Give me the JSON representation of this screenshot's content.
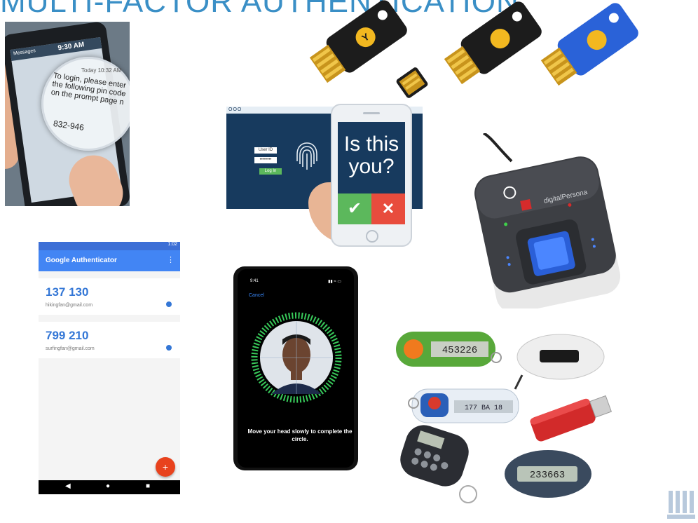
{
  "title": "MULTI-FACTOR AUTHENTICATION",
  "sms": {
    "time": "9:30 AM",
    "back": "Messages",
    "today": "Today 10:32 AM",
    "message": "To login, please enter the following pin code on the prompt page n",
    "pin": "832-946"
  },
  "hardware_keys": {
    "colors": [
      "#1c1c1c",
      "#1c1c1c",
      "#1c1c1c",
      "#2a62d8"
    ],
    "accent": "#f2b820"
  },
  "push_auth": {
    "window_dots": "OOO",
    "user_id_label": "User ID",
    "password_mask": "••••••••",
    "login_button": "Log In",
    "question": "Is this you?",
    "approve_symbol": "✔",
    "deny_symbol": "✕"
  },
  "fingerprint_reader": {
    "brand": "digitalPersona"
  },
  "google_authenticator": {
    "status_time": "1:02",
    "app_title": "Google Authenticator",
    "menu_icon": "⋮",
    "accounts": [
      {
        "code": "137 130",
        "email": "hikingfan@gmail.com"
      },
      {
        "code": "799 210",
        "email": "surfingfan@gmail.com"
      }
    ],
    "fab_label": "+",
    "nav": [
      "◀",
      "●",
      "■"
    ]
  },
  "face_id": {
    "time": "9:41",
    "status": "▮▮ ≈ ▭",
    "cancel": "Cancel",
    "instruction": "Move your head slowly to complete the circle."
  },
  "tokens": {
    "green_token_display": "453226",
    "blue_token_display": "177 BA 18",
    "oval_token_display": "233663"
  }
}
